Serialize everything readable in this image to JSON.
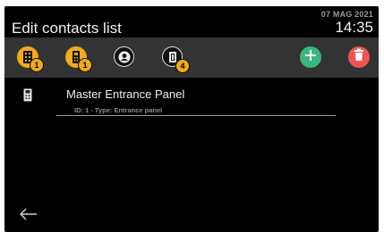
{
  "header": {
    "title": "Edit contacts list",
    "date": "07 MAG 2021",
    "time": "14:35"
  },
  "toolbar": {
    "buttons": [
      {
        "icon": "apartment-list-icon",
        "badge": "1"
      },
      {
        "icon": "entrance-panel-icon",
        "badge": "1",
        "selected": true
      },
      {
        "icon": "user-contact-icon",
        "badge": ""
      },
      {
        "icon": "door-device-icon",
        "badge": "4"
      }
    ],
    "add_icon": "plus-icon",
    "delete_icon": "trash-icon",
    "colors": {
      "accent": "#f2a91a",
      "add": "#3bb77e",
      "delete": "#f05454",
      "bar": "#333333"
    }
  },
  "contacts": [
    {
      "name": "Master Entrance Panel",
      "details": "ID: 1 - Type: Entrance panel",
      "icon": "entrance-panel-icon"
    }
  ],
  "nav": {
    "back_icon": "back-arrow-icon"
  }
}
